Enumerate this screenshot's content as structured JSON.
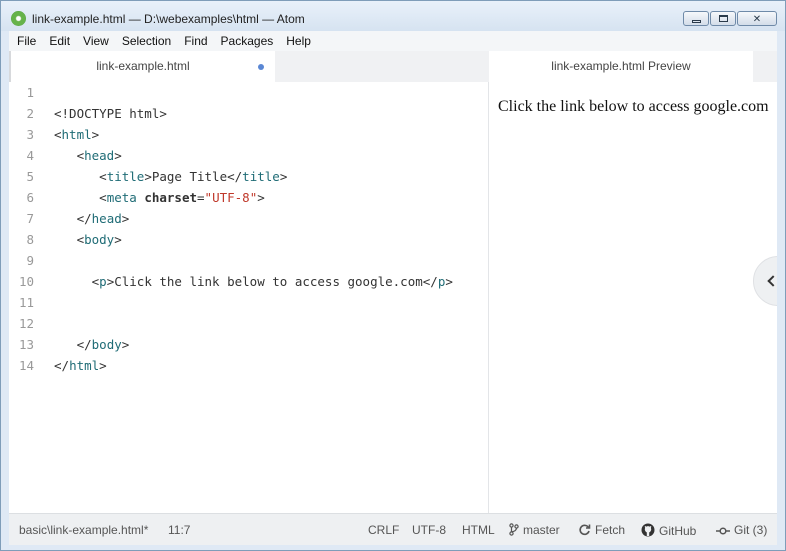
{
  "window": {
    "title": "link-example.html — D:\\webexamples\\html — Atom",
    "controls": {
      "minimize": "",
      "maximize": "",
      "close": "✕"
    }
  },
  "menu": [
    "File",
    "Edit",
    "View",
    "Selection",
    "Find",
    "Packages",
    "Help"
  ],
  "tabs": {
    "editor": {
      "label": "link-example.html",
      "modified": true
    },
    "preview": {
      "label": "link-example.html Preview"
    }
  },
  "editor": {
    "line_numbers": [
      "1",
      "2",
      "3",
      "4",
      "5",
      "6",
      "7",
      "8",
      "9",
      "10",
      "11",
      "12",
      "13",
      "14"
    ],
    "lines": [
      [],
      [
        [
          "p",
          "<!DOCTYPE html>"
        ]
      ],
      [
        [
          "p",
          "<"
        ],
        [
          "t",
          "html"
        ],
        [
          "p",
          ">"
        ]
      ],
      [
        [
          "p",
          "   <"
        ],
        [
          "t",
          "head"
        ],
        [
          "p",
          ">"
        ]
      ],
      [
        [
          "p",
          "      <"
        ],
        [
          "t",
          "title"
        ],
        [
          "p",
          ">Page Title</"
        ],
        [
          "t",
          "title"
        ],
        [
          "p",
          ">"
        ]
      ],
      [
        [
          "p",
          "      <"
        ],
        [
          "t",
          "meta"
        ],
        [
          "p",
          " "
        ],
        [
          "a",
          "charset"
        ],
        [
          "p",
          "="
        ],
        [
          "s",
          "\"UTF-8\""
        ],
        [
          "p",
          ">"
        ]
      ],
      [
        [
          "p",
          "   </"
        ],
        [
          "t",
          "head"
        ],
        [
          "p",
          ">"
        ]
      ],
      [
        [
          "p",
          "   <"
        ],
        [
          "t",
          "body"
        ],
        [
          "p",
          ">"
        ]
      ],
      [],
      [
        [
          "p",
          "     <"
        ],
        [
          "t",
          "p"
        ],
        [
          "p",
          ">Click the link below to access google.com</"
        ],
        [
          "t",
          "p"
        ],
        [
          "p",
          ">"
        ]
      ],
      [],
      [],
      [
        [
          "p",
          "   </"
        ],
        [
          "t",
          "body"
        ],
        [
          "p",
          ">"
        ]
      ],
      [
        [
          "p",
          "</"
        ],
        [
          "t",
          "html"
        ],
        [
          "p",
          ">"
        ]
      ]
    ]
  },
  "preview": {
    "text": "Click the link below to access google.com"
  },
  "statusbar": {
    "file": "basic\\link-example.html*",
    "cursor": "11:7",
    "line_ending": "CRLF",
    "encoding": "UTF-8",
    "grammar": "HTML",
    "branch": "master",
    "fetch": "Fetch",
    "github": "GitHub",
    "git": "Git (3)"
  },
  "colors": {
    "tag": "#1f6c76",
    "string": "#c0392b",
    "modified_dot": "#5a87d4"
  }
}
